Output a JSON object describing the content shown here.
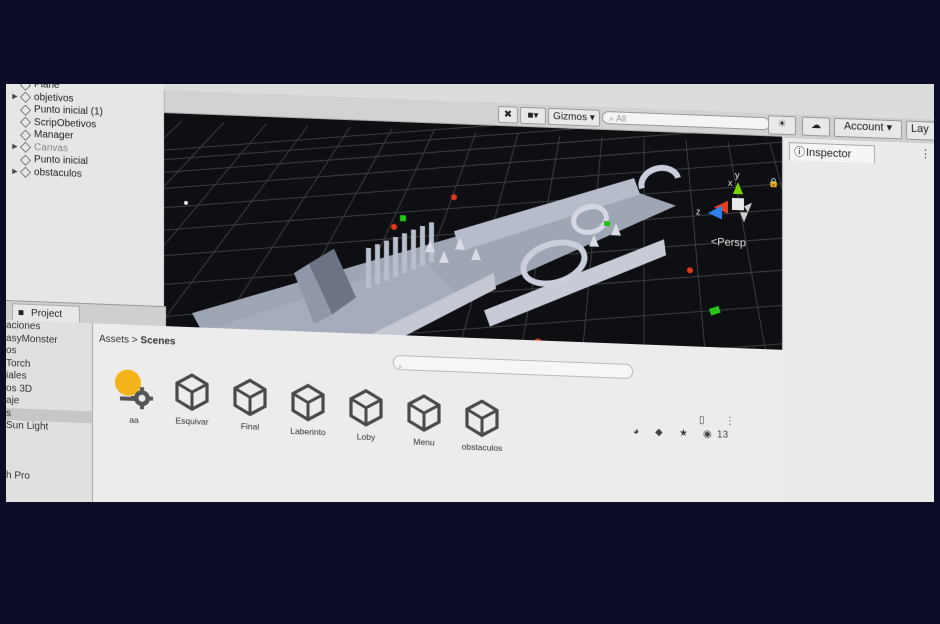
{
  "hierarchy": {
    "items": [
      {
        "label": "Plane",
        "expand": false,
        "dim": false
      },
      {
        "label": "objetivos",
        "expand": true,
        "dim": false
      },
      {
        "label": "Punto inicial (1)",
        "expand": false,
        "dim": false
      },
      {
        "label": "ScripObetivos",
        "expand": false,
        "dim": false
      },
      {
        "label": "Manager",
        "expand": false,
        "dim": false
      },
      {
        "label": "Canvas",
        "expand": true,
        "dim": true
      },
      {
        "label": "Punto inicial",
        "expand": false,
        "dim": false
      },
      {
        "label": "obstaculos",
        "expand": true,
        "dim": false
      }
    ]
  },
  "scene": {
    "gizmos_label": "Gizmos",
    "search_placeholder": "All",
    "persp_label": "<Persp",
    "axis_labels": {
      "x": "x",
      "y": "y",
      "z": "z"
    }
  },
  "topbar": {
    "account_label": "Account",
    "layers_label": "Lay"
  },
  "inspector": {
    "tab_label": "Inspector"
  },
  "project": {
    "tab_label": "Project",
    "breadcrumb_root": "Assets",
    "breadcrumb_sep": ">",
    "breadcrumb_current": "Scenes",
    "hidden_count": "13",
    "left_items": [
      {
        "label": "aciones",
        "selected": false
      },
      {
        "label": "asyMonster",
        "selected": false
      },
      {
        "label": "os",
        "selected": false
      },
      {
        "label": "Torch",
        "selected": false
      },
      {
        "label": "iales",
        "selected": false
      },
      {
        "label": "os 3D",
        "selected": false
      },
      {
        "label": "aje",
        "selected": false
      },
      {
        "label": "s",
        "selected": true
      },
      {
        "label": "Sun Light",
        "selected": false
      },
      {
        "label": "",
        "selected": false
      },
      {
        "label": "",
        "selected": false
      },
      {
        "label": "",
        "selected": false
      },
      {
        "label": "h Pro",
        "selected": false
      }
    ],
    "assets": [
      {
        "name": "aa",
        "icon": "lighting-settings-icon"
      },
      {
        "name": "Esquivar",
        "icon": "unity-scene-icon"
      },
      {
        "name": "Final",
        "icon": "unity-scene-icon"
      },
      {
        "name": "Laberinto",
        "icon": "unity-scene-icon"
      },
      {
        "name": "Loby",
        "icon": "unity-scene-icon"
      },
      {
        "name": "Menu",
        "icon": "unity-scene-icon"
      },
      {
        "name": "obstaculos",
        "icon": "unity-scene-icon"
      }
    ]
  },
  "colors": {
    "background": "#0b0c26",
    "scene_bg": "#0e0f12",
    "axis_y": "#7bd400",
    "axis_x": "#e8401c",
    "axis_z": "#2f7fe8",
    "marker_red": "#e0391a",
    "marker_green": "#27c21a",
    "lighting_bulb": "#f2b31b"
  }
}
